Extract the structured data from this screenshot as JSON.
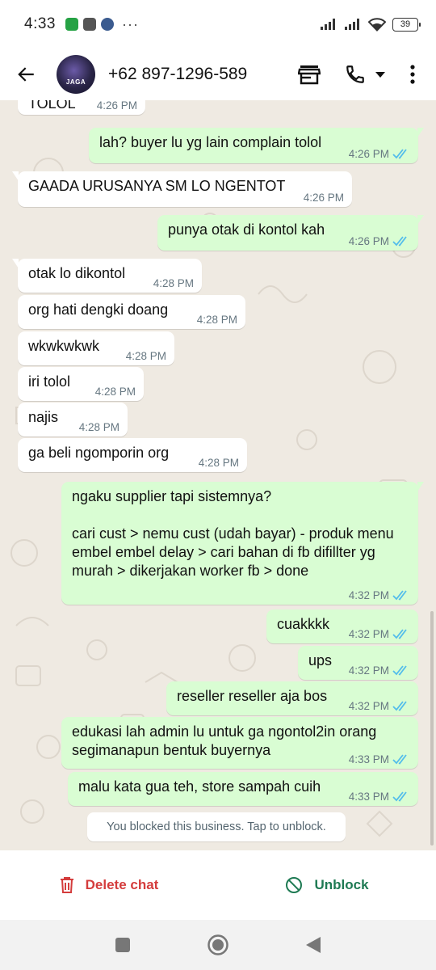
{
  "status_bar": {
    "time": "4:33",
    "more": "···",
    "battery": "39"
  },
  "header": {
    "contact_name": "+62 897-1296-589",
    "avatar_text": "JAGA"
  },
  "messages": [
    {
      "dir": "in",
      "text": "TOLOL",
      "time": "4:26 PM"
    },
    {
      "dir": "out",
      "text": "lah? buyer lu yg lain complain tolol",
      "time": "4:26 PM"
    },
    {
      "dir": "in",
      "text": "GAADA URUSANYA SM LO NGENTOT",
      "time": "4:26 PM"
    },
    {
      "dir": "out",
      "text": "punya otak di kontol kah",
      "time": "4:26 PM"
    },
    {
      "dir": "in",
      "text": "otak lo dikontol",
      "time": "4:28 PM"
    },
    {
      "dir": "in",
      "text": "org hati dengki doang",
      "time": "4:28 PM"
    },
    {
      "dir": "in",
      "text": "wkwkwkwk",
      "time": "4:28 PM"
    },
    {
      "dir": "in",
      "text": "iri tolol",
      "time": "4:28 PM"
    },
    {
      "dir": "in",
      "text": "najis",
      "time": "4:28 PM"
    },
    {
      "dir": "in",
      "text": "ga beli ngomporin org",
      "time": "4:28 PM"
    },
    {
      "dir": "out",
      "text": "ngaku supplier tapi sistemnya?\n\ncari cust > nemu cust (udah bayar) - produk menu embel embel delay > cari bahan di fb difillter yg murah > dikerjakan worker fb > done",
      "time": "4:32 PM"
    },
    {
      "dir": "out",
      "text": "cuakkkk",
      "time": "4:32 PM"
    },
    {
      "dir": "out",
      "text": "ups",
      "time": "4:32 PM"
    },
    {
      "dir": "out",
      "text": "reseller reseller aja bos",
      "time": "4:32 PM"
    },
    {
      "dir": "out",
      "text": "edukasi lah admin lu untuk ga ngontol2in orang segimanapun bentuk buyernya",
      "time": "4:33 PM"
    },
    {
      "dir": "out",
      "text": "malu kata gua teh, store sampah cuih",
      "time": "4:33 PM"
    }
  ],
  "system_message": "You blocked this business. Tap to unblock.",
  "actions": {
    "delete_label": "Delete chat",
    "unblock_label": "Unblock"
  },
  "colors": {
    "chat_bg": "#efeae2",
    "outgoing_bubble": "#d9fdd3",
    "incoming_bubble": "#ffffff",
    "read_ticks": "#53bdeb",
    "delete": "#d43c3c",
    "unblock": "#1e7a53"
  },
  "icons": {
    "back": "arrow-left-icon",
    "store": "store-icon",
    "call": "phone-icon",
    "dropdown": "caret-down-icon",
    "menu": "more-vert-icon",
    "delete": "trash-icon",
    "unblock": "block-icon",
    "read": "double-check-icon"
  }
}
